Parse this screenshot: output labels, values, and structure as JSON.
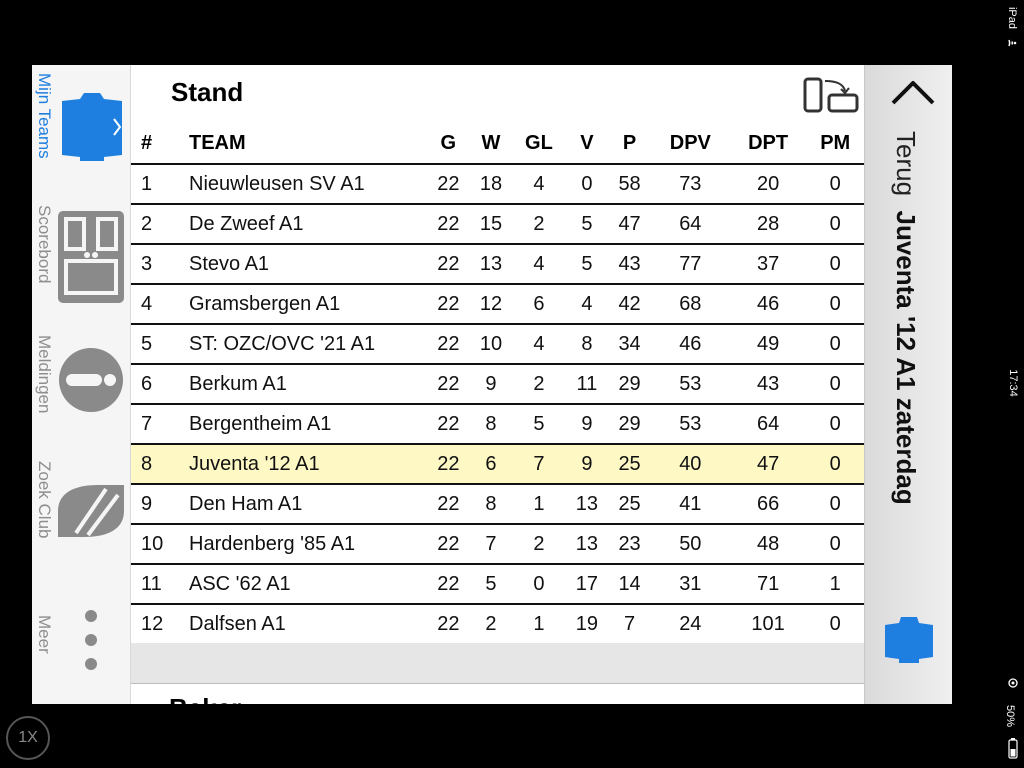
{
  "status_bar": {
    "device": "iPad",
    "time": "17:34",
    "battery": "50%"
  },
  "zoom": {
    "label": "1X"
  },
  "tabbar": {
    "items": [
      {
        "label": "Mijn Teams",
        "icon": "shirt-icon",
        "active": true
      },
      {
        "label": "Scorebord",
        "icon": "scoreboard-icon",
        "active": false
      },
      {
        "label": "Meldingen",
        "icon": "alert-icon",
        "active": false
      },
      {
        "label": "Zoek Club",
        "icon": "badge-icon",
        "active": false
      },
      {
        "label": "Meer",
        "icon": "more-icon",
        "active": false
      }
    ]
  },
  "content": {
    "title": "Stand",
    "next_section": "Beker",
    "rotate_icon": "rotate-device-icon",
    "table": {
      "headers": [
        "#",
        "TEAM",
        "G",
        "W",
        "GL",
        "V",
        "P",
        "DPV",
        "DPT",
        "PM"
      ],
      "highlight_row": 7,
      "rows": [
        [
          "1",
          "Nieuwleusen SV A1",
          "22",
          "18",
          "4",
          "0",
          "58",
          "73",
          "20",
          "0"
        ],
        [
          "2",
          "De Zweef A1",
          "22",
          "15",
          "2",
          "5",
          "47",
          "64",
          "28",
          "0"
        ],
        [
          "3",
          "Stevo A1",
          "22",
          "13",
          "4",
          "5",
          "43",
          "77",
          "37",
          "0"
        ],
        [
          "4",
          "Gramsbergen A1",
          "22",
          "12",
          "6",
          "4",
          "42",
          "68",
          "46",
          "0"
        ],
        [
          "5",
          "ST: OZC/OVC '21 A1",
          "22",
          "10",
          "4",
          "8",
          "34",
          "46",
          "49",
          "0"
        ],
        [
          "6",
          "Berkum A1",
          "22",
          "9",
          "2",
          "11",
          "29",
          "53",
          "43",
          "0"
        ],
        [
          "7",
          "Bergentheim A1",
          "22",
          "8",
          "5",
          "9",
          "29",
          "53",
          "64",
          "0"
        ],
        [
          "8",
          "Juventa '12 A1",
          "22",
          "6",
          "7",
          "9",
          "25",
          "40",
          "47",
          "0"
        ],
        [
          "9",
          "Den Ham A1",
          "22",
          "8",
          "1",
          "13",
          "25",
          "41",
          "66",
          "0"
        ],
        [
          "10",
          "Hardenberg '85 A1",
          "22",
          "7",
          "2",
          "13",
          "23",
          "50",
          "48",
          "0"
        ],
        [
          "11",
          "ASC '62 A1",
          "22",
          "5",
          "0",
          "17",
          "14",
          "31",
          "71",
          "1"
        ],
        [
          "12",
          "Dalfsen A1",
          "22",
          "2",
          "1",
          "19",
          "7",
          "24",
          "101",
          "0"
        ]
      ]
    }
  },
  "navbar": {
    "back_label": "Terug",
    "team_title": "Juventa '12 A1 zaterdag",
    "shirt_icon": "shirt-icon"
  },
  "colors": {
    "accent": "#1e7fe0",
    "highlight": "#fdf8c4",
    "inactive": "#8e8e8e"
  }
}
